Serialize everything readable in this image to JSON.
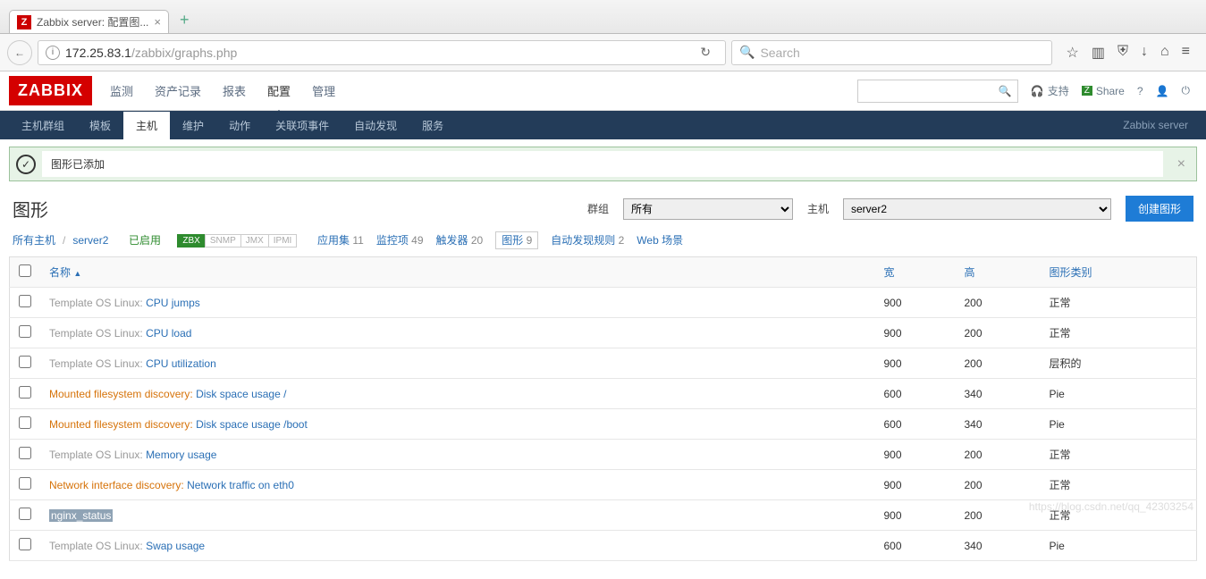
{
  "browser": {
    "tab_title": "Zabbix server: 配置图...",
    "url_host": "172.25.83.1",
    "url_path": "/zabbix/graphs.php",
    "search_placeholder": "Search"
  },
  "topnav": {
    "logo": "ZABBIX",
    "items": [
      "监测",
      "资产记录",
      "报表",
      "配置",
      "管理"
    ],
    "active_index": 3,
    "support": "支持",
    "share": "Share",
    "help": "?"
  },
  "subnav": {
    "items": [
      "主机群组",
      "模板",
      "主机",
      "维护",
      "动作",
      "关联项事件",
      "自动发现",
      "服务"
    ],
    "active_index": 2,
    "server_label": "Zabbix server"
  },
  "message": {
    "text": "图形已添加"
  },
  "page": {
    "title": "图形",
    "group_label": "群组",
    "group_value": "所有",
    "host_label": "主机",
    "host_value": "server2",
    "create_btn": "创建图形"
  },
  "crumb": {
    "all_hosts": "所有主机",
    "host": "server2",
    "enabled": "已启用",
    "badges": [
      "ZBX",
      "SNMP",
      "JMX",
      "IPMI"
    ],
    "links": [
      {
        "label": "应用集",
        "count": "11"
      },
      {
        "label": "监控项",
        "count": "49"
      },
      {
        "label": "触发器",
        "count": "20"
      },
      {
        "label": "图形",
        "count": "9",
        "active": true
      },
      {
        "label": "自动发现规则",
        "count": "2"
      },
      {
        "label": "Web 场景",
        "count": ""
      }
    ]
  },
  "table": {
    "headers": {
      "name": "名称",
      "width": "宽",
      "height": "高",
      "type": "图形类别"
    },
    "rows": [
      {
        "prefix": "Template OS Linux: ",
        "prefix_d": false,
        "name": "CPU jumps",
        "w": "900",
        "h": "200",
        "t": "正常"
      },
      {
        "prefix": "Template OS Linux: ",
        "prefix_d": false,
        "name": "CPU load",
        "w": "900",
        "h": "200",
        "t": "正常"
      },
      {
        "prefix": "Template OS Linux: ",
        "prefix_d": false,
        "name": "CPU utilization",
        "w": "900",
        "h": "200",
        "t": "层积的"
      },
      {
        "prefix": "Mounted filesystem discovery: ",
        "prefix_d": true,
        "name": "Disk space usage /",
        "w": "600",
        "h": "340",
        "t": "Pie"
      },
      {
        "prefix": "Mounted filesystem discovery: ",
        "prefix_d": true,
        "name": "Disk space usage /boot",
        "w": "600",
        "h": "340",
        "t": "Pie"
      },
      {
        "prefix": "Template OS Linux: ",
        "prefix_d": false,
        "name": "Memory usage",
        "w": "900",
        "h": "200",
        "t": "正常"
      },
      {
        "prefix": "Network interface discovery: ",
        "prefix_d": true,
        "name": "Network traffic on eth0",
        "w": "900",
        "h": "200",
        "t": "正常"
      },
      {
        "prefix": "",
        "prefix_d": false,
        "name": "nginx_status",
        "highlight": true,
        "w": "900",
        "h": "200",
        "t": "正常"
      },
      {
        "prefix": "Template OS Linux: ",
        "prefix_d": false,
        "name": "Swap usage",
        "w": "600",
        "h": "340",
        "t": "Pie"
      }
    ]
  },
  "watermark": "https://blog.csdn.net/qq_42303254"
}
